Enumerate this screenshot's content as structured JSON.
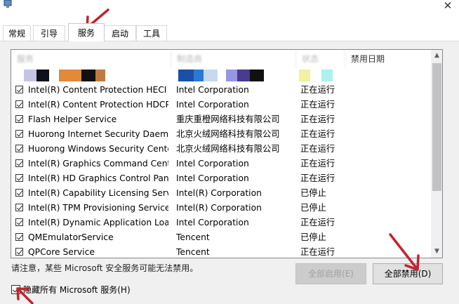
{
  "tabs": [
    {
      "label": "常规",
      "active": false
    },
    {
      "label": "引导",
      "active": false
    },
    {
      "label": "服务",
      "active": true
    },
    {
      "label": "启动",
      "active": false
    },
    {
      "label": "工具",
      "active": false
    }
  ],
  "columns": {
    "service": "服务",
    "maker": "制造商",
    "status": "状态",
    "disabled_date": "禁用日期"
  },
  "services": [
    {
      "name": "Intel(R) Content Protection HECI ...",
      "maker": "Intel Corporation",
      "status": "正在运行",
      "checked": true
    },
    {
      "name": "Intel(R) Content Protection HDCP...",
      "maker": "Intel Corporation",
      "status": "正在运行",
      "checked": true
    },
    {
      "name": "Flash Helper Service",
      "maker": "重庆重橙网络科技有限公司",
      "status": "正在运行",
      "checked": true
    },
    {
      "name": "Huorong Internet Security Daem...",
      "maker": "北京火绒网络科技有限公司",
      "status": "正在运行",
      "checked": true
    },
    {
      "name": "Huorong Windows Security Center",
      "maker": "北京火绒网络科技有限公司",
      "status": "正在运行",
      "checked": true
    },
    {
      "name": "Intel(R) Graphics Command Cent...",
      "maker": "Intel Corporation",
      "status": "正在运行",
      "checked": true
    },
    {
      "name": "Intel(R) HD Graphics Control Pan...",
      "maker": "Intel Corporation",
      "status": "正在运行",
      "checked": true
    },
    {
      "name": "Intel(R) Capability Licensing Servi...",
      "maker": "Intel(R) Corporation",
      "status": "已停止",
      "checked": true
    },
    {
      "name": "Intel(R) TPM Provisioning Service",
      "maker": "Intel(R) Corporation",
      "status": "已停止",
      "checked": true
    },
    {
      "name": "Intel(R) Dynamic Application Loa...",
      "maker": "Intel Corporation",
      "status": "正在运行",
      "checked": true
    },
    {
      "name": "QMEmulatorService",
      "maker": "Tencent",
      "status": "已停止",
      "checked": true
    },
    {
      "name": "QPCore Service",
      "maker": "Tencent",
      "status": "正在运行",
      "checked": true
    }
  ],
  "notice": "请注意，某些 Microsoft 安全服务可能无法禁用。",
  "buttons": {
    "enable_all": "全部启用(E)",
    "disable_all": "全部禁用(D)"
  },
  "hide_ms": {
    "label": "隐藏所有 Microsoft 服务(H)",
    "checked": true
  },
  "colors": {
    "annotation_arrow": "#c0262c",
    "panel_bg": "#f0f0f0",
    "scroll_thumb": "#c2c2c2"
  }
}
